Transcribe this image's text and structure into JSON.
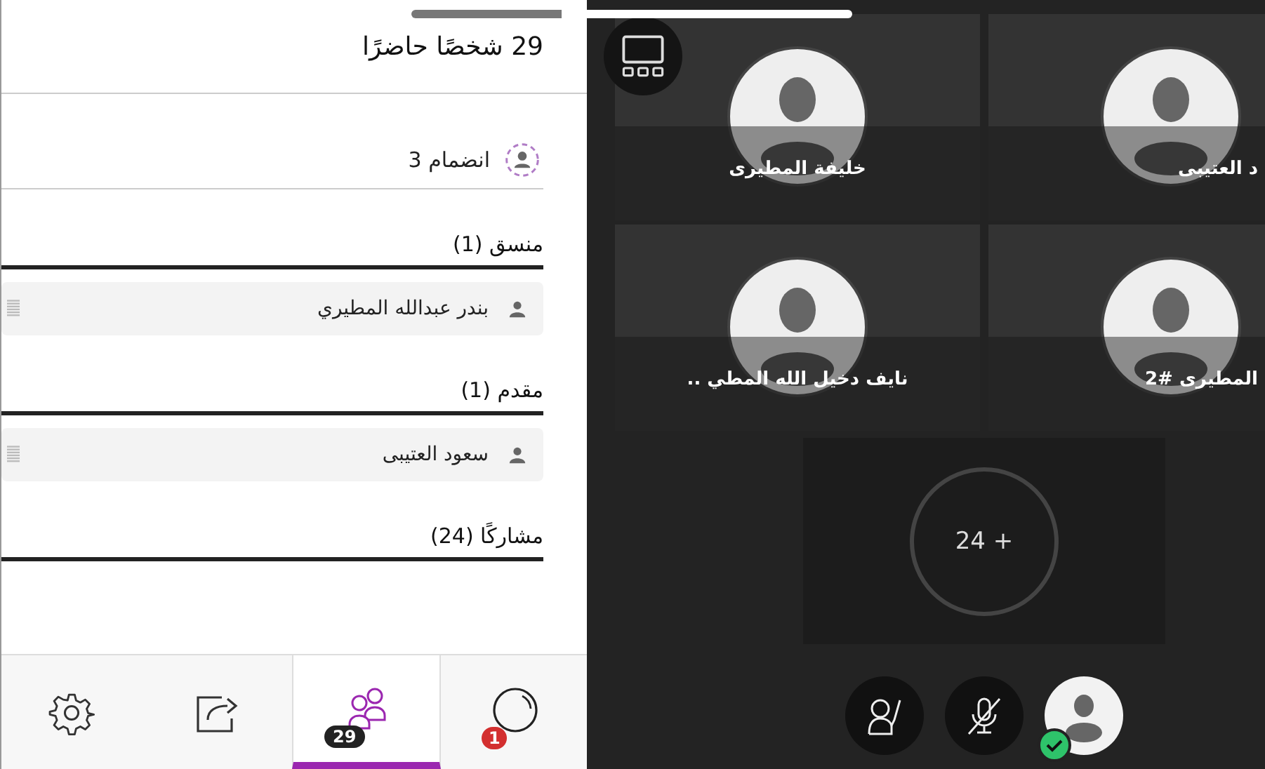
{
  "attendees_panel": {
    "title": "29 شخصًا حاضرًا",
    "joining": {
      "label": "انضمام 3"
    },
    "sections": [
      {
        "heading": "منسق (1)",
        "people": [
          {
            "name": "بندر عبدالله المطيري"
          }
        ]
      },
      {
        "heading": "مقدم (1)",
        "people": [
          {
            "name": "سعود العتيبى"
          }
        ]
      },
      {
        "heading": "مشاركًا (24)"
      }
    ]
  },
  "tabs": [
    {
      "kind": "chat",
      "selected": false,
      "badge": "1"
    },
    {
      "kind": "attendees",
      "selected": true,
      "badge": "29"
    },
    {
      "kind": "share",
      "selected": false
    },
    {
      "kind": "settings",
      "selected": false
    }
  ],
  "video_grid": {
    "tiles": [
      {
        "name": "د العتيبى"
      },
      {
        "name": "خليفة المطيرى"
      },
      {
        "name": "المطيرى #2"
      },
      {
        "name": "نايف دخيل الله المطي .."
      }
    ],
    "overflow": {
      "label": "24 +"
    }
  },
  "controls": [
    {
      "kind": "raise-hand"
    },
    {
      "kind": "microphone",
      "muted": true
    },
    {
      "kind": "avatar",
      "ready": true
    }
  ]
}
